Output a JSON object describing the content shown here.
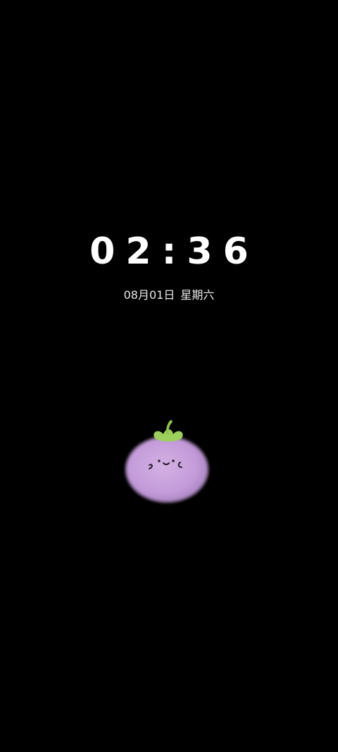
{
  "lockscreen": {
    "time": "02:36",
    "date": "08月01日",
    "weekday": "星期六"
  },
  "wallpaper": {
    "background_color": "#000000",
    "mascot_icon": "mangosteen-icon",
    "mascot_body_color": "#c9a3de",
    "mascot_leaf_color": "#9ccf5b"
  }
}
